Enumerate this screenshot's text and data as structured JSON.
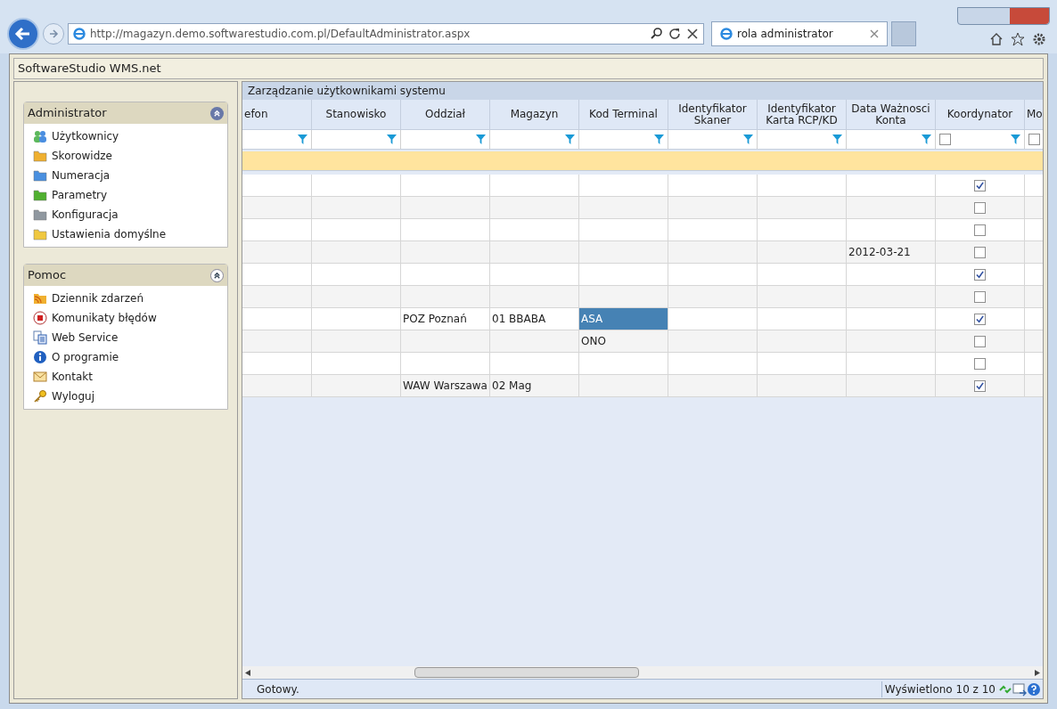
{
  "browser": {
    "address": "http://magazyn.demo.softwarestudio.com.pl/DefaultAdministrator.aspx",
    "tab_title": "rola administrator"
  },
  "app_title": "SoftwareStudio WMS.net",
  "sidebar": [
    {
      "title": "Administrator",
      "expanded": true,
      "items": [
        {
          "label": "Użytkownicy",
          "kind": "users"
        },
        {
          "label": "Skorowidze",
          "kind": "folder",
          "color": "#f0b030"
        },
        {
          "label": "Numeracja",
          "kind": "folder",
          "color": "#4a90e0"
        },
        {
          "label": "Parametry",
          "kind": "folder",
          "color": "#50b030"
        },
        {
          "label": "Konfiguracja",
          "kind": "folder",
          "color": "#9098a0"
        },
        {
          "label": "Ustawienia domyślne",
          "kind": "folder",
          "color": "#f0c840"
        }
      ]
    },
    {
      "title": "Pomoc",
      "expanded": true,
      "items": [
        {
          "label": "Dziennik zdarzeń",
          "kind": "feed"
        },
        {
          "label": "Komunikaty błędów",
          "kind": "stop"
        },
        {
          "label": "Web Service",
          "kind": "document"
        },
        {
          "label": "O programie",
          "kind": "info"
        },
        {
          "label": "Kontakt",
          "kind": "mail"
        },
        {
          "label": "Wyloguj",
          "kind": "key"
        }
      ]
    }
  ],
  "grid": {
    "title": "Zarządzanie użytkownikami systemu",
    "columns": [
      {
        "label": "efon",
        "kind": "text"
      },
      {
        "label": "Stanowisko",
        "kind": "text"
      },
      {
        "label": "Oddział",
        "kind": "text"
      },
      {
        "label": "Magazyn",
        "kind": "text"
      },
      {
        "label": "Kod Terminal",
        "kind": "text"
      },
      {
        "label": "Identyfikator Skaner",
        "kind": "text"
      },
      {
        "label": "Identyfikator Karta RCP/KD",
        "kind": "text"
      },
      {
        "label": "Data Ważnosci Konta",
        "kind": "text"
      },
      {
        "label": "Koordynator",
        "kind": "checkbox",
        "filter_checked": false
      },
      {
        "label": "Mo",
        "kind": "partial",
        "filter_checked": false
      }
    ],
    "rows": [
      {
        "koordynator": true
      },
      {
        "koordynator": false
      },
      {
        "koordynator": false
      },
      {
        "data_waznosci": "2012-03-21",
        "koordynator": false
      },
      {
        "koordynator": true
      },
      {
        "koordynator": false
      },
      {
        "oddzial": "POZ Poznań",
        "magazyn": "01 BBABA",
        "kod_terminal": "ASA",
        "kod_terminal_selected": true,
        "koordynator": true
      },
      {
        "kod_terminal": "ONO",
        "kod_terminal_selected": false,
        "koordynator": false
      },
      {
        "koordynator": false
      },
      {
        "oddzial": "WAW Warszawa",
        "magazyn": "02 Mag",
        "koordynator": true
      }
    ]
  },
  "status": {
    "text": "Gotowy.",
    "count": "Wyświetlono 10 z 10"
  }
}
